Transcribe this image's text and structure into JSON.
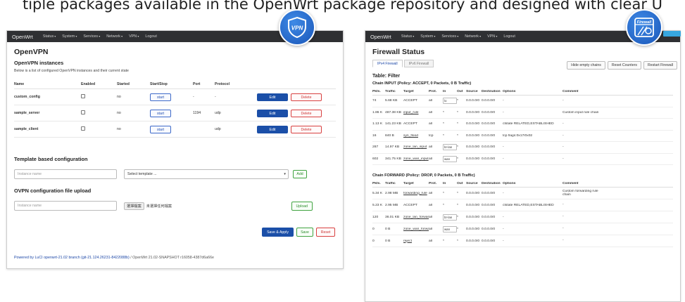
{
  "headline": "tiple packages available in the OpenWrt package repository and designed with clear U",
  "badges": {
    "vpn_label": "VPN",
    "firewall_label": "Firewall"
  },
  "openvpn": {
    "nav": {
      "brand": "OpenWrt",
      "items": [
        "Status",
        "System",
        "Services",
        "Network",
        "VPN",
        "Logout"
      ]
    },
    "title": "OpenVPN",
    "instances_heading": "OpenVPN instances",
    "description": "Below is a list of configured OpenVPN instances and their current state",
    "columns": [
      "Name",
      "Enabled",
      "Started",
      "Start/Stop",
      "Port",
      "Protocol"
    ],
    "rows": [
      {
        "name": "custom_config",
        "started": "no",
        "action": "start",
        "port": "-",
        "protocol": "-"
      },
      {
        "name": "sample_server",
        "started": "no",
        "action": "start",
        "port": "1194",
        "protocol": "udp"
      },
      {
        "name": "sample_client",
        "started": "no",
        "action": "start",
        "port": "",
        "protocol": "udp"
      }
    ],
    "edit_label": "Edit",
    "delete_label": "Delete",
    "template_heading": "Template based configuration",
    "template_name_placeholder": "Instance name",
    "template_select": "Select template ...",
    "add_label": "Add",
    "upload_heading": "OVPN configuration file upload",
    "upload_name_placeholder": "Instance name",
    "choose_file": "選擇檔案",
    "no_file": "未選擇任何檔案",
    "upload_label": "Upload",
    "save_apply": "Save & Apply",
    "save": "Save",
    "reset": "Reset",
    "footer_link": "Powered by LuCI openwrt-21.02 branch (git-21.124.26231-8422088b)",
    "footer_plain": " / OpenWrt 21.02-SNAPSHOT r16058-4387d6a66e"
  },
  "firewall": {
    "nav": {
      "brand": "OpenWrt",
      "items": [
        "Status",
        "System",
        "Services",
        "Network",
        "VPN",
        "Logout"
      ]
    },
    "title": "Firewall Status",
    "tabs": [
      "IPv4 Firewall",
      "IPv6 Firewall"
    ],
    "buttons": [
      "Hide empty chains",
      "Reset Counters",
      "Restart Firewall"
    ],
    "table_heading": "Table: Filter",
    "input_chain": "Chain INPUT (Policy: ACCEPT, 0 Packets, 0 B Traffic)",
    "forward_chain": "Chain FORWARD (Policy: DROP, 0 Packets, 0 B Traffic)",
    "columns": [
      "Pkts.",
      "Traffic",
      "Target",
      "Prot.",
      "In",
      "Out",
      "Source",
      "Destination",
      "Options",
      "Comment"
    ],
    "input_rows": [
      {
        "pkts": "74",
        "traffic": "5.68 KB",
        "target": "ACCEPT",
        "prot": "all",
        "in": "lo",
        "out": "*",
        "src": "0.0.0.0/0",
        "dst": "0.0.0.0/0",
        "opts": "-",
        "comment": "-"
      },
      {
        "pkts": "1.86 K",
        "traffic": "487.38 KB",
        "target": "input_rule",
        "prot": "all",
        "in": "*",
        "out": "*",
        "src": "0.0.0.0/0",
        "dst": "0.0.0.0/0",
        "opts": "-",
        "comment": "Custom input rule chain"
      },
      {
        "pkts": "1.13 K",
        "traffic": "141.23 KB",
        "target": "ACCEPT",
        "prot": "all",
        "in": "*",
        "out": "*",
        "src": "0.0.0.0/0",
        "dst": "0.0.0.0/0",
        "opts": "ctstate RELATED,ESTABLISHED",
        "comment": "-"
      },
      {
        "pkts": "16",
        "traffic": "840 B",
        "target": "syn_flood",
        "prot": "tcp",
        "in": "*",
        "out": "*",
        "src": "0.0.0.0/0",
        "dst": "0.0.0.0/0",
        "opts": "tcp flags:0x17/0x02",
        "comment": "-"
      },
      {
        "pkts": "287",
        "traffic": "14.97 KB",
        "target": "zone_lan_input",
        "prot": "all",
        "in": "br-lan",
        "out": "*",
        "src": "0.0.0.0/0",
        "dst": "0.0.0.0/0",
        "opts": "-",
        "comment": "-"
      },
      {
        "pkts": "602",
        "traffic": "341.75 KB",
        "target": "zone_wan_input",
        "prot": "all",
        "in": "wan",
        "out": "*",
        "src": "0.0.0.0/0",
        "dst": "0.0.0.0/0",
        "opts": "-",
        "comment": "-"
      }
    ],
    "forward_rows": [
      {
        "pkts": "5.34 K",
        "traffic": "2.98 MB",
        "target": "forwarding_rule",
        "prot": "all",
        "in": "*",
        "out": "*",
        "src": "0.0.0.0/0",
        "dst": "0.0.0.0/0",
        "opts": "-",
        "comment": "Custom forwarding rule chain"
      },
      {
        "pkts": "5.23 K",
        "traffic": "2.95 MB",
        "target": "ACCEPT",
        "prot": "all",
        "in": "*",
        "out": "*",
        "src": "0.0.0.0/0",
        "dst": "0.0.0.0/0",
        "opts": "ctstate RELATED,ESTABLISHED",
        "comment": "-"
      },
      {
        "pkts": "120",
        "traffic": "36.01 KB",
        "target": "zone_lan_forward",
        "prot": "all",
        "in": "br-lan",
        "out": "*",
        "src": "0.0.0.0/0",
        "dst": "0.0.0.0/0",
        "opts": "-",
        "comment": "-"
      },
      {
        "pkts": "0",
        "traffic": "0 B",
        "target": "zone_wan_forward",
        "prot": "all",
        "in": "wan",
        "out": "*",
        "src": "0.0.0.0/0",
        "dst": "0.0.0.0/0",
        "opts": "-",
        "comment": "-"
      },
      {
        "pkts": "0",
        "traffic": "0 B",
        "target": "reject",
        "prot": "all",
        "in": "*",
        "out": "*",
        "src": "0.0.0.0/0",
        "dst": "0.0.0.0/0",
        "opts": "-",
        "comment": "-"
      }
    ]
  },
  "colors": {
    "navbar": "#2f3033",
    "primary_blue": "#1b4fa8",
    "danger_red": "#d84040",
    "success_green": "#41a341",
    "badge_blue": "#2a6fd1",
    "accent_cyan": "#37a7e0"
  }
}
